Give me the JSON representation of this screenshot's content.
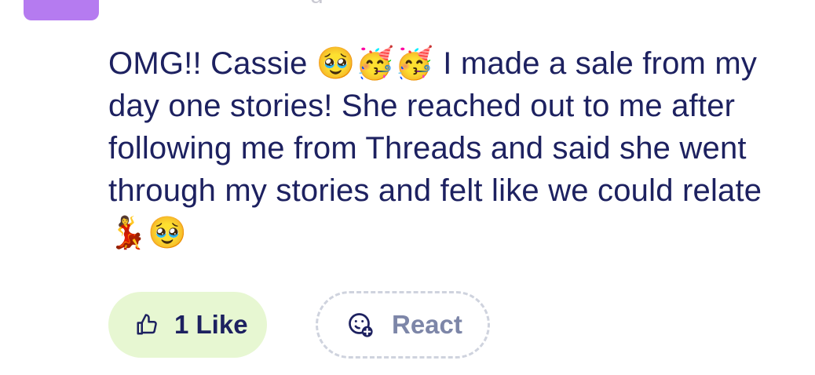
{
  "post": {
    "author_name_partial": "g",
    "message": "OMG!! Cassie 🥹🥳🥳 I made a sale from my day one stories! She reached out to me after following me from Threads and said she went through my stories and felt like we could relate 💃🥹"
  },
  "actions": {
    "like_label": "1 Like",
    "react_label": "React",
    "like_icon": "thumbs-up-icon",
    "react_icon": "smiley-plus-icon"
  },
  "colors": {
    "text": "#1d2160",
    "avatar": "#b57bf0",
    "like_bg": "#e7f7d2",
    "react_text": "#7d86a8",
    "react_border": "#cfd3de"
  }
}
